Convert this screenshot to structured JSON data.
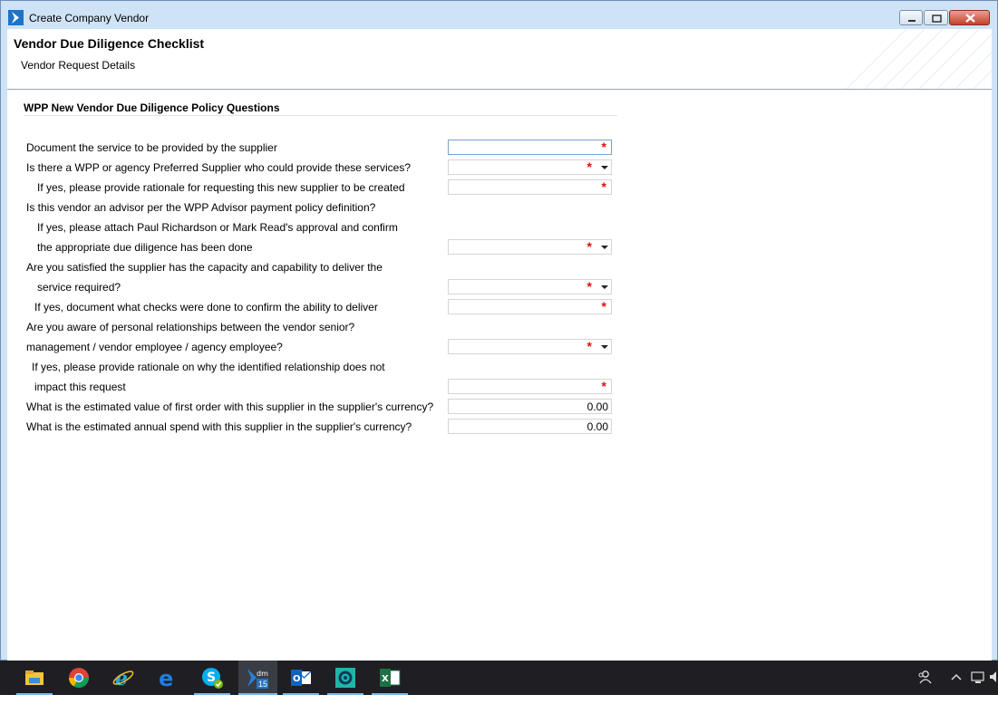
{
  "window": {
    "title": "Create Company Vendor",
    "accent": "#1e73c8"
  },
  "header": {
    "title": "Vendor Due Diligence Checklist",
    "subtitle": "Vendor Request Details"
  },
  "section": {
    "title": "WPP New Vendor Due Diligence Policy Questions"
  },
  "labels": {
    "q1": "Document the service to be provided by the supplier",
    "q2": "Is there a WPP or agency Preferred Supplier who could provide these services?",
    "q2a": "If yes, please provide rationale for requesting this new supplier to be created",
    "q3": "Is this vendor an advisor per the WPP Advisor payment policy definition?",
    "q3a_1": "If yes, please attach Paul Richardson or Mark Read's approval and confirm",
    "q3a_2": "the appropriate due diligence has been done",
    "q4_1": "Are you satisfied the supplier has the capacity and capability to deliver the",
    "q4_2": "service required?",
    "q4a": "If yes, document what checks were done to confirm the ability to deliver",
    "q5_1": "Are you aware of personal relationships between the vendor senior?",
    "q5_2": "management / vendor employee / agency employee?",
    "q5a_1": "If yes, please provide rationale on why the identified relationship does not",
    "q5a_2": "impact this request",
    "q6": "What is the estimated value of first order with this supplier in the supplier's currency?",
    "q7": "What is the estimated annual spend with this supplier in the supplier's currency?"
  },
  "fields": {
    "required_mark": "*",
    "required_color": "#e01010",
    "first_order_value": "0.00",
    "annual_spend_value": "0.00"
  },
  "taskbar": {
    "apps": [
      "file-explorer",
      "chrome",
      "internet-explorer",
      "edge",
      "skype",
      "dm-15",
      "outlook",
      "app-gear",
      "excel"
    ],
    "active_app": "dm-15",
    "dm_badge": "15"
  }
}
